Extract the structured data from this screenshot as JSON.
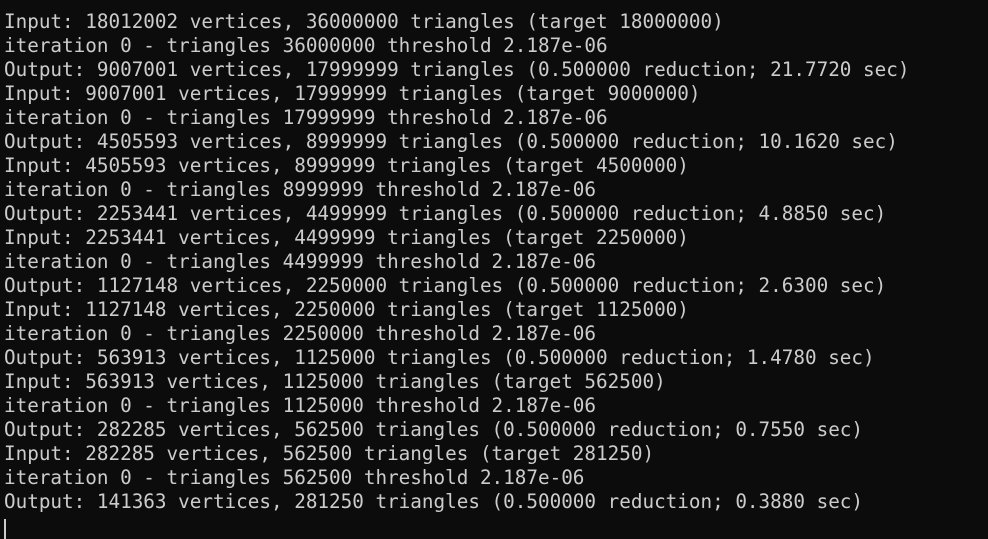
{
  "terminal": {
    "lines": [
      "Input: 18012002 vertices, 36000000 triangles (target 18000000)",
      "iteration 0 - triangles 36000000 threshold 2.187e-06",
      "Output: 9007001 vertices, 17999999 triangles (0.500000 reduction; 21.7720 sec)",
      "Input: 9007001 vertices, 17999999 triangles (target 9000000)",
      "iteration 0 - triangles 17999999 threshold 2.187e-06",
      "Output: 4505593 vertices, 8999999 triangles (0.500000 reduction; 10.1620 sec)",
      "Input: 4505593 vertices, 8999999 triangles (target 4500000)",
      "iteration 0 - triangles 8999999 threshold 2.187e-06",
      "Output: 2253441 vertices, 4499999 triangles (0.500000 reduction; 4.8850 sec)",
      "Input: 2253441 vertices, 4499999 triangles (target 2250000)",
      "iteration 0 - triangles 4499999 threshold 2.187e-06",
      "Output: 1127148 vertices, 2250000 triangles (0.500000 reduction; 2.6300 sec)",
      "Input: 1127148 vertices, 2250000 triangles (target 1125000)",
      "iteration 0 - triangles 2250000 threshold 2.187e-06",
      "Output: 563913 vertices, 1125000 triangles (0.500000 reduction; 1.4780 sec)",
      "Input: 563913 vertices, 1125000 triangles (target 562500)",
      "iteration 0 - triangles 1125000 threshold 2.187e-06",
      "Output: 282285 vertices, 562500 triangles (0.500000 reduction; 0.7550 sec)",
      "Input: 282285 vertices, 562500 triangles (target 281250)",
      "iteration 0 - triangles 562500 threshold 2.187e-06",
      "Output: 141363 vertices, 281250 triangles (0.500000 reduction; 0.3880 sec)"
    ]
  },
  "colors": {
    "background": "#0c0c0c",
    "text": "#cccccc"
  }
}
